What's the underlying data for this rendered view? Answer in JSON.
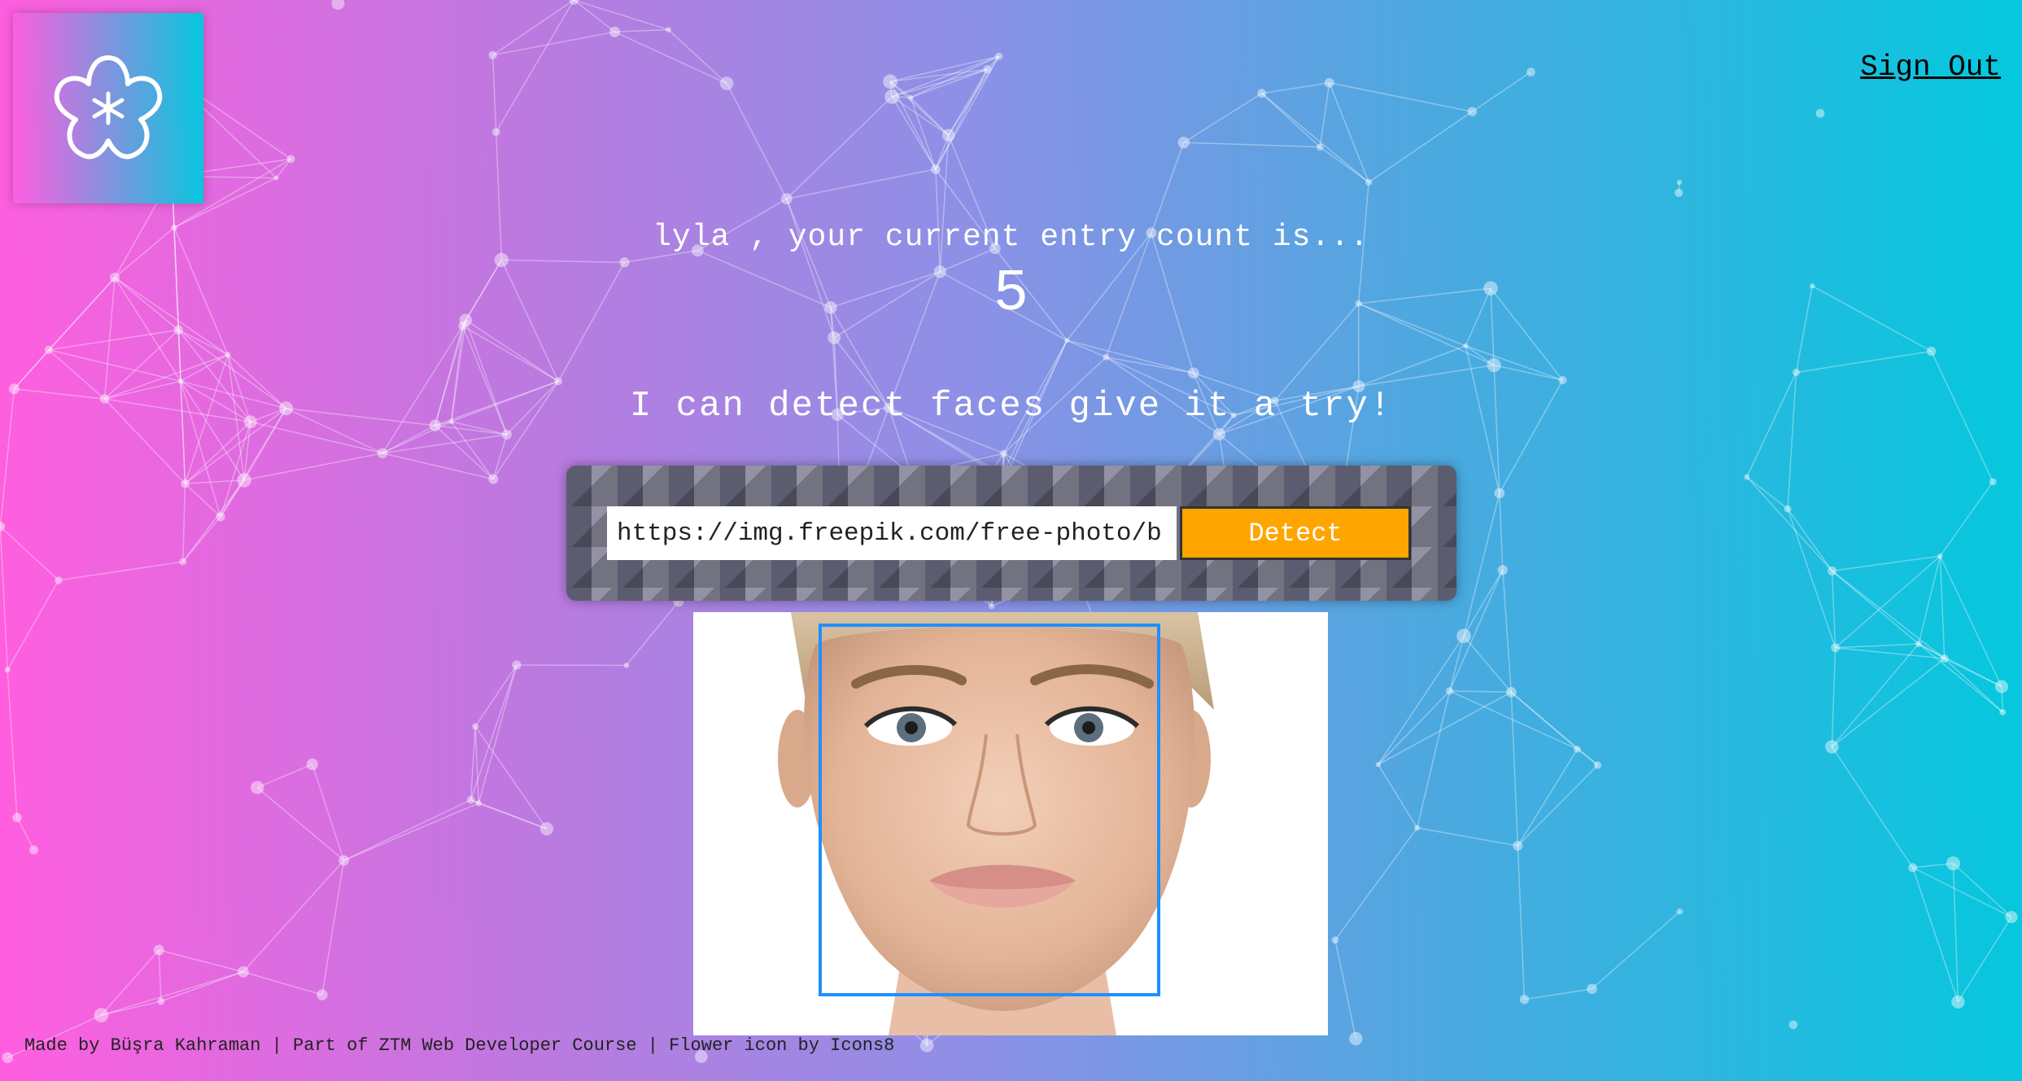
{
  "header": {
    "logo_icon": "flower-icon",
    "sign_out_label": "Sign Out"
  },
  "rank": {
    "greeting": "lyla , your current entry count is...",
    "count": "5"
  },
  "tagline": "I can detect faces give it a try!",
  "form": {
    "url_value": "https://img.freepik.com/free-photo/b",
    "detect_label": "Detect"
  },
  "face_recognition": {
    "image_icon": "portrait-photo",
    "box_color": "#1e90ff"
  },
  "footer": {
    "text": "Made by Büşra Kahraman | Part of ZTM Web Developer Course | Flower icon by Icons8"
  },
  "colors": {
    "gradient_start": "#ff5edf",
    "gradient_end": "#04c8de",
    "button_orange": "#ffa500"
  }
}
